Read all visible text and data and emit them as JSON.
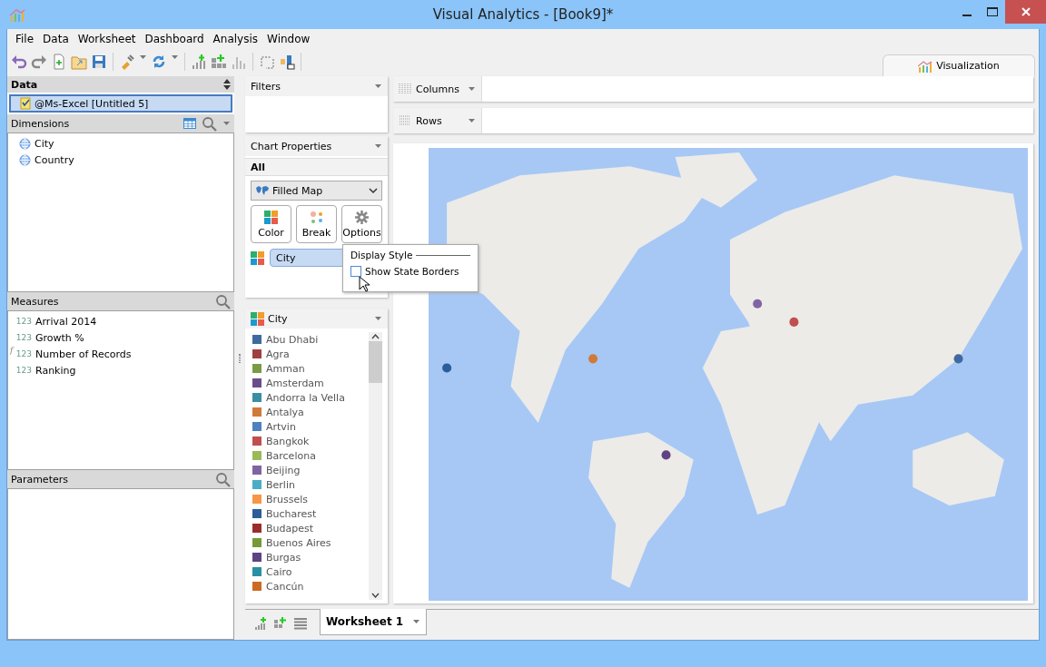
{
  "window": {
    "title": "Visual Analytics - [Book9]*"
  },
  "menu": [
    "File",
    "Data",
    "Worksheet",
    "Dashboard",
    "Analysis",
    "Window"
  ],
  "view_tabs": [
    {
      "label": "Visualization",
      "selected": true
    }
  ],
  "data_panel": {
    "title": "Data",
    "sources": [
      {
        "label": "@Ms-Excel [Untitled 5]",
        "selected": true
      }
    ]
  },
  "dimensions": {
    "title": "Dimensions",
    "items": [
      {
        "label": "City",
        "kind": "geo"
      },
      {
        "label": "Country",
        "kind": "geo"
      }
    ]
  },
  "measures": {
    "title": "Measures",
    "items": [
      {
        "label": "Arrival 2014",
        "kind": "number",
        "type_label": "123"
      },
      {
        "label": "Growth %",
        "kind": "number",
        "type_label": "123"
      },
      {
        "label": "Number of Records",
        "kind": "calculated",
        "type_label": "123",
        "formula_mark": "f"
      },
      {
        "label": "Ranking",
        "kind": "number",
        "type_label": "123"
      }
    ]
  },
  "parameters": {
    "title": "Parameters"
  },
  "filters": {
    "title": "Filters"
  },
  "chart_properties": {
    "title": "Chart Properties",
    "section": "All",
    "chart_type": "Filled Map",
    "buttons": [
      {
        "label": "Color",
        "kind": "color"
      },
      {
        "label": "Break",
        "kind": "break"
      },
      {
        "label": "Options",
        "kind": "options"
      }
    ],
    "color_field": "City",
    "popup": {
      "title": "Display Style",
      "option": {
        "label": "Show State Borders",
        "checked": false
      }
    }
  },
  "legend": {
    "title": "City",
    "items": [
      {
        "label": "Abu Dhabi",
        "color": "#3e6aa0"
      },
      {
        "label": "Agra",
        "color": "#a04040"
      },
      {
        "label": "Amman",
        "color": "#7a9a45"
      },
      {
        "label": "Amsterdam",
        "color": "#6a4e8a"
      },
      {
        "label": "Andorra la Vella",
        "color": "#3a8fa0"
      },
      {
        "label": "Antalya",
        "color": "#d07a3a"
      },
      {
        "label": "Artvin",
        "color": "#4f80c0"
      },
      {
        "label": "Bangkok",
        "color": "#c05050"
      },
      {
        "label": "Barcelona",
        "color": "#9aba58"
      },
      {
        "label": "Beijing",
        "color": "#8064a2"
      },
      {
        "label": "Berlin",
        "color": "#4bacc6"
      },
      {
        "label": "Brussels",
        "color": "#f79646"
      },
      {
        "label": "Bucharest",
        "color": "#2c5d98"
      },
      {
        "label": "Budapest",
        "color": "#9c2c2c"
      },
      {
        "label": "Buenos Aires",
        "color": "#779a36"
      },
      {
        "label": "Burgas",
        "color": "#5f4283"
      },
      {
        "label": "Cairo",
        "color": "#2a8fa3"
      },
      {
        "label": "Cancún",
        "color": "#cd6a22"
      }
    ]
  },
  "shelves": [
    {
      "label": "Columns",
      "kind": "columns"
    },
    {
      "label": "Rows",
      "kind": "rows"
    }
  ],
  "sheet_tabs": [
    {
      "label": "Worksheet 1",
      "selected": true
    }
  ]
}
